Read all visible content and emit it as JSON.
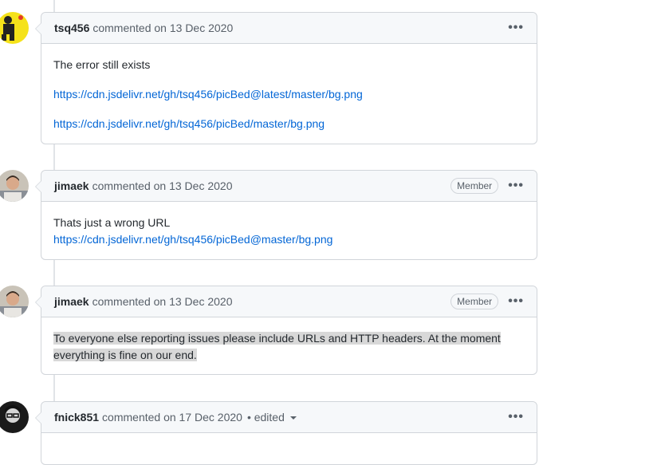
{
  "comments": [
    {
      "author": "tsq456",
      "meta": "commented on 13 Dec 2020",
      "badge": "",
      "menu": "•••",
      "lines": [
        "The error still exists",
        "https://cdn.jsdelivr.net/gh/tsq456/picBed@latest/master/bg.png",
        "https://cdn.jsdelivr.net/gh/tsq456/picBed/master/bg.png"
      ]
    },
    {
      "author": "jimaek",
      "meta": "commented on 13 Dec 2020",
      "badge": "Member",
      "menu": "•••",
      "lines": [
        "Thats just a wrong URL",
        "https://cdn.jsdelivr.net/gh/tsq456/picBed@master/bg.png"
      ]
    },
    {
      "author": "jimaek",
      "meta": "commented on 13 Dec 2020",
      "badge": "Member",
      "menu": "•••",
      "lines": [
        "To everyone else reporting issues please include URLs and HTTP headers. At the moment everything is fine on our end."
      ]
    },
    {
      "author": "fnick851",
      "meta": "commented on 17 Dec 2020",
      "edited": "• edited",
      "menu": "•••"
    }
  ]
}
